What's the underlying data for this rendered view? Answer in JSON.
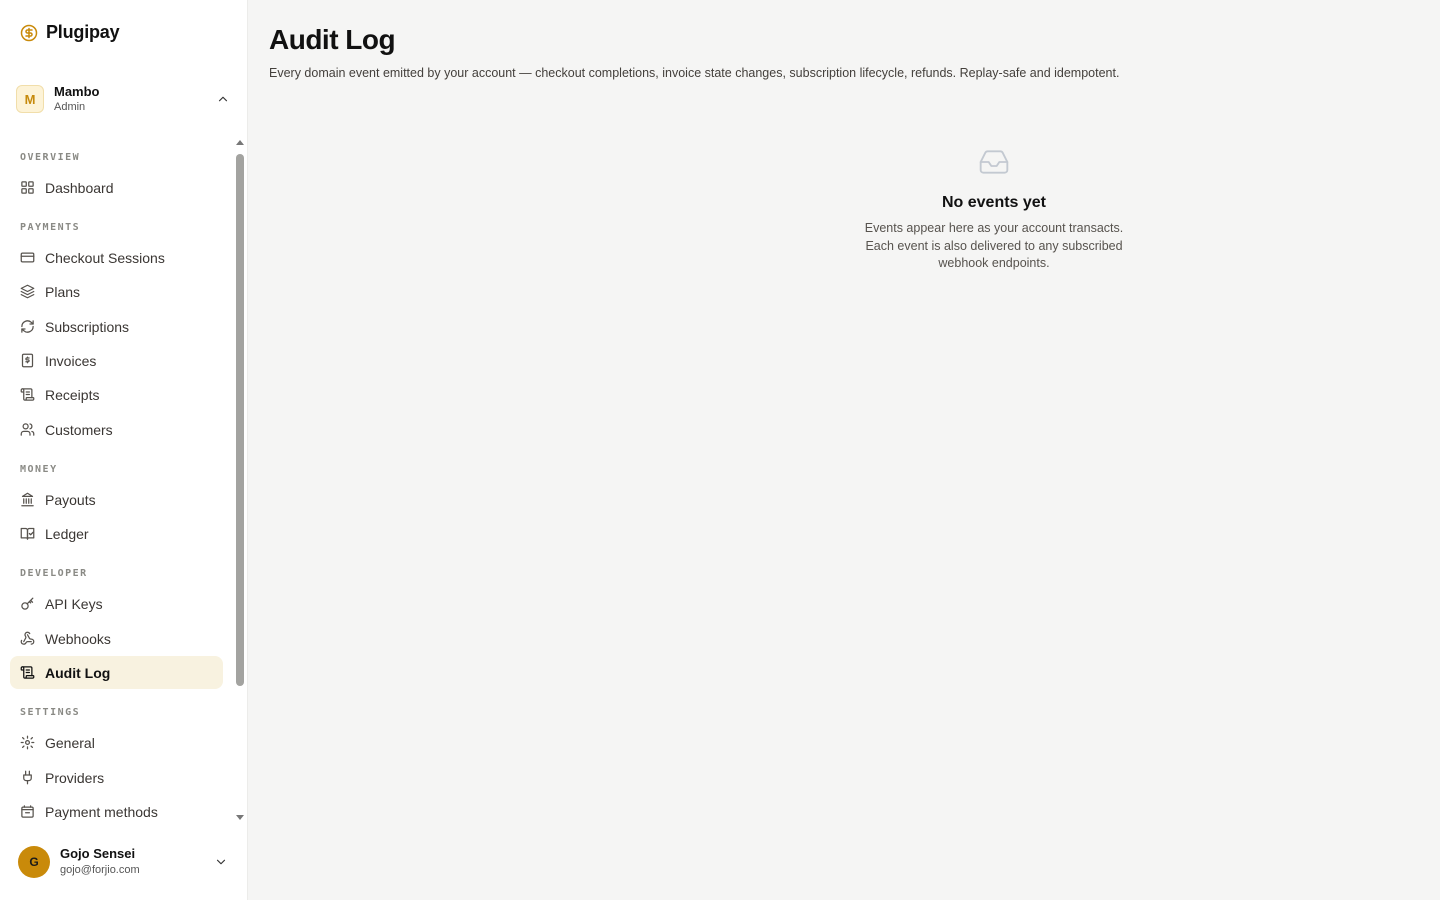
{
  "brand": {
    "name": "Plugipay",
    "accent": "#c98a0a"
  },
  "org": {
    "initial": "M",
    "name": "Mambo",
    "role": "Admin"
  },
  "nav": {
    "sections": {
      "overview": "OVERVIEW",
      "payments": "PAYMENTS",
      "money": "MONEY",
      "developer": "DEVELOPER",
      "settings": "SETTINGS"
    },
    "items": {
      "dashboard": "Dashboard",
      "checkout_sessions": "Checkout Sessions",
      "plans": "Plans",
      "subscriptions": "Subscriptions",
      "invoices": "Invoices",
      "receipts": "Receipts",
      "customers": "Customers",
      "payouts": "Payouts",
      "ledger": "Ledger",
      "api_keys": "API Keys",
      "webhooks": "Webhooks",
      "audit_log": "Audit Log",
      "general": "General",
      "providers": "Providers",
      "payment_methods": "Payment methods"
    },
    "active": "audit_log"
  },
  "user": {
    "initial": "G",
    "name": "Gojo Sensei",
    "email": "gojo@forjio.com"
  },
  "page": {
    "title": "Audit Log",
    "description": "Every domain event emitted by your account — checkout completions, invoice state changes, subscription lifecycle, refunds. Replay-safe and idempotent."
  },
  "empty_state": {
    "icon": "inbox-icon",
    "title": "No events yet",
    "line1": "Events appear here as your account transacts.",
    "line2": "Each event is also delivered to any subscribed",
    "line3": "webhook endpoints."
  }
}
